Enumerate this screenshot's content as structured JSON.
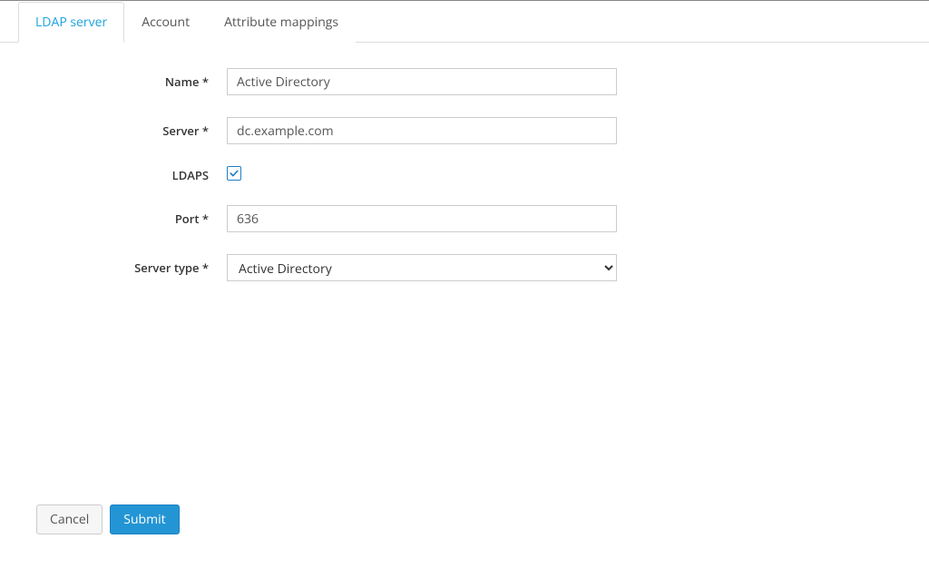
{
  "tabs": {
    "ldap_server": "LDAP server",
    "account": "Account",
    "attribute_mappings": "Attribute mappings"
  },
  "form": {
    "name": {
      "label": "Name *",
      "value": "Active Directory"
    },
    "server": {
      "label": "Server *",
      "value": "dc.example.com"
    },
    "ldaps": {
      "label": "LDAPS",
      "checked": true
    },
    "port": {
      "label": "Port *",
      "value": "636"
    },
    "server_type": {
      "label": "Server type *",
      "value": "Active Directory"
    }
  },
  "buttons": {
    "cancel": "Cancel",
    "submit": "Submit"
  }
}
